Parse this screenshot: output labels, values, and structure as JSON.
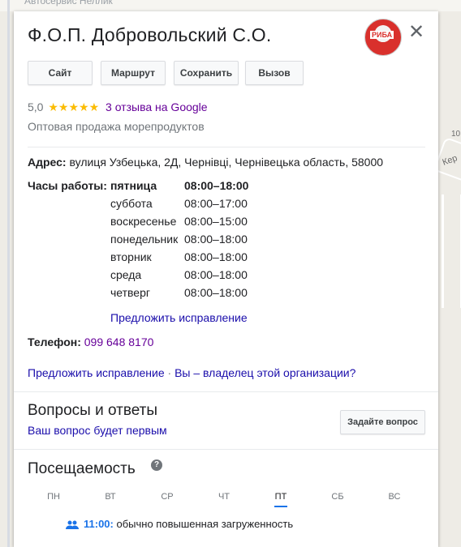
{
  "map": {
    "top_label": "Автосервис Неллик",
    "right_label1": "Кер",
    "right_label2": "10"
  },
  "card": {
    "title": "Ф.О.П. Добровольский С.О.",
    "logo_text": "РИБА",
    "buttons": [
      "Сайт",
      "Маршрут",
      "Сохранить",
      "Вызов"
    ],
    "rating": "5,0",
    "stars": "★★★★★",
    "reviews": "3 отзыва на Google",
    "category": "Оптовая продажа морепродуктов",
    "address_label": "Адрес:",
    "address": "вулиця Узбецька, 2Д, Чернівці, Чернівецька область, 58000",
    "hours_label": "Часы работы:",
    "hours": [
      {
        "day": "пятница",
        "time": "08:00–18:00"
      },
      {
        "day": "суббота",
        "time": "08:00–17:00"
      },
      {
        "day": "воскресенье",
        "time": "08:00–15:00"
      },
      {
        "day": "понедельник",
        "time": "08:00–18:00"
      },
      {
        "day": "вторник",
        "time": "08:00–18:00"
      },
      {
        "day": "среда",
        "time": "08:00–18:00"
      },
      {
        "day": "четверг",
        "time": "08:00–18:00"
      }
    ],
    "suggest_edit": "Предложить исправление",
    "phone_label": "Телефон:",
    "phone": "099 648 8170",
    "suggest_edit2": "Предложить исправление",
    "owner_separator": " · ",
    "owner_link": "Вы – владелец этой организации?",
    "qa_title": "Вопросы и ответы",
    "qa_sub": "Ваш вопрос будет первым",
    "ask_button": "Задайте вопрос",
    "popularity_title": "Посещаемость",
    "help_icon": "?",
    "days": [
      "ПН",
      "ВТ",
      "СР",
      "ЧТ",
      "ПТ",
      "СБ",
      "ВС"
    ],
    "active_day": "ПТ",
    "busy_time": "11:00:",
    "busy_text": " обычно повышенная загруженность"
  },
  "colors": {
    "link": "#1a0dab",
    "visited": "#660099",
    "star": "#fbbc04",
    "accent": "#1a73e8"
  }
}
